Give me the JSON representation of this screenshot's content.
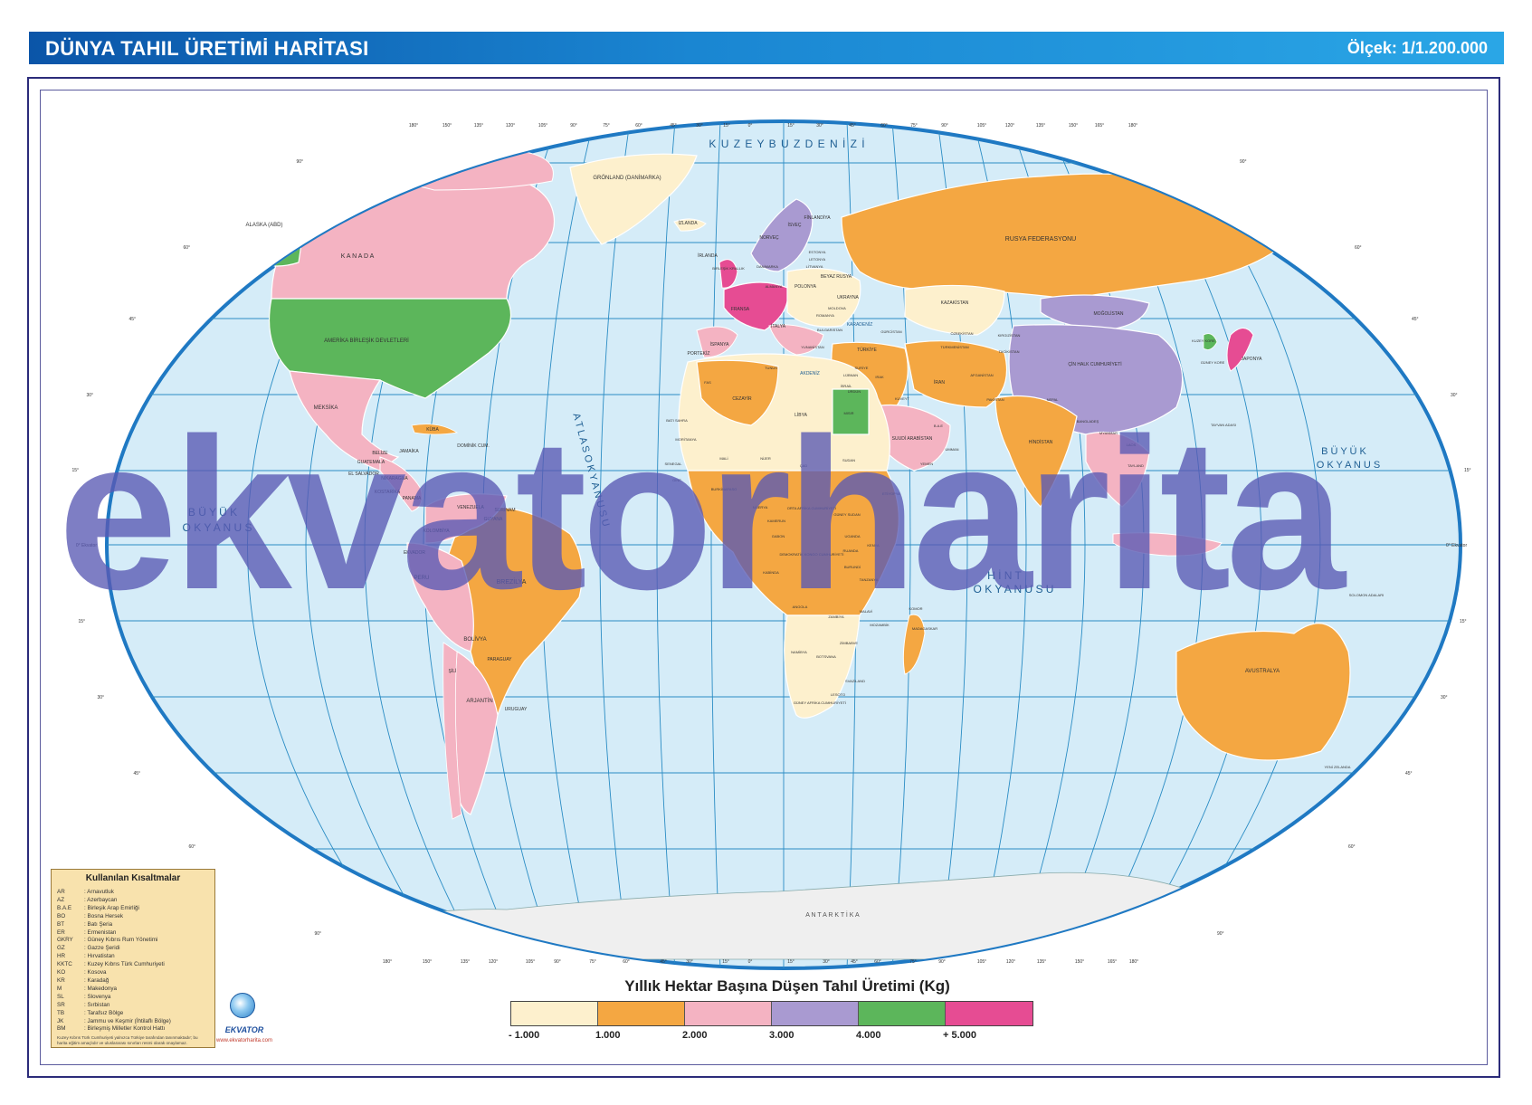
{
  "header": {
    "title": "DÜNYA TAHIL ÜRETİMİ HARİTASI",
    "scale": "Ölçek: 1/1.200.000"
  },
  "legend": {
    "title": "Yıllık Hektar Başına Düşen Tahıl Üretimi (Kg)",
    "classes": [
      {
        "color": "#fdf0cd"
      },
      {
        "color": "#f4a742"
      },
      {
        "color": "#f4b3c2"
      },
      {
        "color": "#a99ad1"
      },
      {
        "color": "#5cb65b"
      },
      {
        "color": "#e64c93"
      }
    ],
    "labels": [
      "- 1.000",
      "1.000",
      "2.000",
      "3.000",
      "4.000",
      "+ 5.000"
    ]
  },
  "abbreviations": {
    "title": "Kullanılan Kısaltmalar",
    "items": [
      {
        "code": "AR",
        "text": ": Arnavutluk"
      },
      {
        "code": "AZ",
        "text": ": Azerbaycan"
      },
      {
        "code": "B.A.E",
        "text": ": Birleşik Arap Emirliği"
      },
      {
        "code": "BO",
        "text": ": Bosna Hersek"
      },
      {
        "code": "BT",
        "text": ": Batı Şeria"
      },
      {
        "code": "ER",
        "text": ": Ermenistan"
      },
      {
        "code": "GKRY",
        "text": ": Güney Kıbrıs Rum Yönetimi"
      },
      {
        "code": "GZ",
        "text": ": Gazze Şeridi"
      },
      {
        "code": "HR",
        "text": ": Hırvatistan"
      },
      {
        "code": "KKTC",
        "text": ": Kuzey Kıbrıs Türk Cumhuriyeti"
      },
      {
        "code": "KO",
        "text": ": Kosova"
      },
      {
        "code": "KR",
        "text": ": Karadağ"
      },
      {
        "code": "M",
        "text": ": Makedonya"
      },
      {
        "code": "SL",
        "text": ": Slovenya"
      },
      {
        "code": "SR",
        "text": ": Sırbistan"
      },
      {
        "code": "TB",
        "text": ": Tarafsız Bölge"
      },
      {
        "code": "JK",
        "text": ": Jammu ve Keşmir (İhtilaflı Bölge)"
      },
      {
        "code": "BM",
        "text": ": Birleşmiş Milletler Kontrol Hattı"
      }
    ],
    "note": "Kuzey Kıbrıs Türk Cumhuriyeti yalnızca Türkiye tarafından tanınmaktadır; bu harita eğitim amaçlıdır ve uluslararası sınırları resmi olarak onaylamaz."
  },
  "logo": {
    "brand": "EKVATOR",
    "url": "www.ekvatorharita.com"
  },
  "watermark": "ekvatorharita",
  "map": {
    "ocean_labels": [
      {
        "id": "arctic",
        "text": "K U Z E Y   B U Z   D E N İ Z İ"
      },
      {
        "id": "atlantic",
        "text": "A T L A S   O K Y A N U S U"
      },
      {
        "id": "pacific-w1",
        "text": "B Ü Y Ü K"
      },
      {
        "id": "pacific-w2",
        "text": "O K Y A N U S"
      },
      {
        "id": "pacific-e1",
        "text": "B Ü Y Ü K"
      },
      {
        "id": "pacific-e2",
        "text": "O K Y A N U S"
      },
      {
        "id": "indian1",
        "text": "H İ N T"
      },
      {
        "id": "indian2",
        "text": "O K Y A N U S U"
      },
      {
        "id": "antarctica",
        "text": "A N T A R K T İ K A"
      }
    ],
    "country_labels": [
      {
        "text": "ALASKA (ABD)"
      },
      {
        "text": "K A N A D A"
      },
      {
        "text": "AMERİKA BİRLEŞİK DEVLETLERİ"
      },
      {
        "text": "GRÖNLAND (DANİMARKA)"
      },
      {
        "text": "İZLANDA"
      },
      {
        "text": "MEKSİKA"
      },
      {
        "text": "KÜBA"
      },
      {
        "text": "DOMİNİK CUM."
      },
      {
        "text": "JAMAİKA"
      },
      {
        "text": "BELİZE"
      },
      {
        "text": "GUATEMALA"
      },
      {
        "text": "EL SALVADOR"
      },
      {
        "text": "NİKARAGUA"
      },
      {
        "text": "KOSTARİKA"
      },
      {
        "text": "PANAMA"
      },
      {
        "text": "KOLOMBİYA"
      },
      {
        "text": "VENEZUELA"
      },
      {
        "text": "GUYANA"
      },
      {
        "text": "SURİNAM"
      },
      {
        "text": "EKVADOR"
      },
      {
        "text": "PERU"
      },
      {
        "text": "BREZİLYA"
      },
      {
        "text": "BOLİVYA"
      },
      {
        "text": "PARAGUAY"
      },
      {
        "text": "ŞİLİ"
      },
      {
        "text": "ARJANTİN"
      },
      {
        "text": "URUGUAY"
      },
      {
        "text": "İRLANDA"
      },
      {
        "text": "BİRLEŞİK KRALLIK"
      },
      {
        "text": "NORVEÇ"
      },
      {
        "text": "İSVEÇ"
      },
      {
        "text": "FİNLANDİYA"
      },
      {
        "text": "DANİMARKA"
      },
      {
        "text": "ESTONYA"
      },
      {
        "text": "LETONYA"
      },
      {
        "text": "LİTVANYA"
      },
      {
        "text": "BEYAZ RUSYA"
      },
      {
        "text": "POLONYA"
      },
      {
        "text": "ALMANYA"
      },
      {
        "text": "FRANSA"
      },
      {
        "text": "İSPANYA"
      },
      {
        "text": "PORTEKİZ"
      },
      {
        "text": "İTALYA"
      },
      {
        "text": "UKRAYNA"
      },
      {
        "text": "ROMANYA"
      },
      {
        "text": "MOLDOVA"
      },
      {
        "text": "BULGARİSTAN"
      },
      {
        "text": "YUNANİSTAN"
      },
      {
        "text": "RUSYA FEDERASYONU"
      },
      {
        "text": "KAZAKİSTAN"
      },
      {
        "text": "MOĞOLİSTAN"
      },
      {
        "text": "ÇİN HALK CUMHURİYETİ"
      },
      {
        "text": "KUZEY KORE"
      },
      {
        "text": "GÜNEY KORE"
      },
      {
        "text": "JAPONYA"
      },
      {
        "text": "TÜRKİYE"
      },
      {
        "text": "GÜRCİSTAN"
      },
      {
        "text": "SURİYE"
      },
      {
        "text": "LÜBNAN"
      },
      {
        "text": "IRAK"
      },
      {
        "text": "İRAN"
      },
      {
        "text": "ÜRDÜN"
      },
      {
        "text": "İSRAİL"
      },
      {
        "text": "KUVEYT"
      },
      {
        "text": "SUUDİ ARABİSTAN"
      },
      {
        "text": "B.A.E"
      },
      {
        "text": "YEMEN"
      },
      {
        "text": "UMMAN"
      },
      {
        "text": "ÖZBEKİSTAN"
      },
      {
        "text": "TÜRKMENİSTAN"
      },
      {
        "text": "KIRGIZİSTAN"
      },
      {
        "text": "TACİKİSTAN"
      },
      {
        "text": "AFGANİSTAN"
      },
      {
        "text": "PAKİSTAN"
      },
      {
        "text": "NEPAL"
      },
      {
        "text": "BANGLADEŞ"
      },
      {
        "text": "HİNDİSTAN"
      },
      {
        "text": "MYANMAR"
      },
      {
        "text": "LAOS"
      },
      {
        "text": "TAYLAND"
      },
      {
        "text": "TAYVAN ADASI"
      },
      {
        "text": "FAS"
      },
      {
        "text": "CEZAYİR"
      },
      {
        "text": "TUNUS"
      },
      {
        "text": "LİBYA"
      },
      {
        "text": "MISIR"
      },
      {
        "text": "BATI SAHRA"
      },
      {
        "text": "MORİTANYA"
      },
      {
        "text": "MALİ"
      },
      {
        "text": "NİJER"
      },
      {
        "text": "ÇAD"
      },
      {
        "text": "SUDAN"
      },
      {
        "text": "GÜNEY SUDAN"
      },
      {
        "text": "ETİYOPYA"
      },
      {
        "text": "SENEGAL"
      },
      {
        "text": "GİNE"
      },
      {
        "text": "BURKİNAFASO"
      },
      {
        "text": "NİJERYA"
      },
      {
        "text": "KAMERUN"
      },
      {
        "text": "ORTA AFRİKA CUMHURİYETİ"
      },
      {
        "text": "GABON"
      },
      {
        "text": "DEMOKRATİK KONGO CUMHURİYETİ"
      },
      {
        "text": "UGANDA"
      },
      {
        "text": "KENYA"
      },
      {
        "text": "RUANDA"
      },
      {
        "text": "BURUNDİ"
      },
      {
        "text": "TANZANYA"
      },
      {
        "text": "KABİNDA"
      },
      {
        "text": "ANGOLA"
      },
      {
        "text": "ZAMBİYA"
      },
      {
        "text": "MALAVİ"
      },
      {
        "text": "MOZAMBİK"
      },
      {
        "text": "ZİMBABVE"
      },
      {
        "text": "NAMİBYA"
      },
      {
        "text": "BOTSVANA"
      },
      {
        "text": "LESOTO"
      },
      {
        "text": "SVAZİLAND"
      },
      {
        "text": "GÜNEY AFRİKA CUMHURİYETİ"
      },
      {
        "text": "MADAGASKAR"
      },
      {
        "text": "KOMOR"
      },
      {
        "text": "AVUSTRALYA"
      },
      {
        "text": "YENİ ZELANDA"
      },
      {
        "text": "SOLOMON ADALARI"
      },
      {
        "text": "AKDENİZ"
      },
      {
        "text": "KARADENİZ"
      }
    ],
    "longitude_labels": [
      "180°",
      "150°",
      "135°",
      "120°",
      "105°",
      "90°",
      "75°",
      "60°",
      "45°",
      "30°",
      "15°",
      "0°",
      "15°",
      "30°",
      "45°",
      "60°",
      "75°",
      "90°",
      "105°",
      "120°",
      "135°",
      "150°",
      "165°",
      "180°"
    ],
    "latitude_labels": [
      "90°",
      "60°",
      "45°",
      "30°",
      "15°",
      "0° Ekvator",
      "15°",
      "30°",
      "45°",
      "60°",
      "90°"
    ],
    "colors": {
      "ocean": "#d5ecf8",
      "graticule": "#2a8cc4",
      "outline": "#1f79c3",
      "antarctica": "#efefef"
    }
  }
}
